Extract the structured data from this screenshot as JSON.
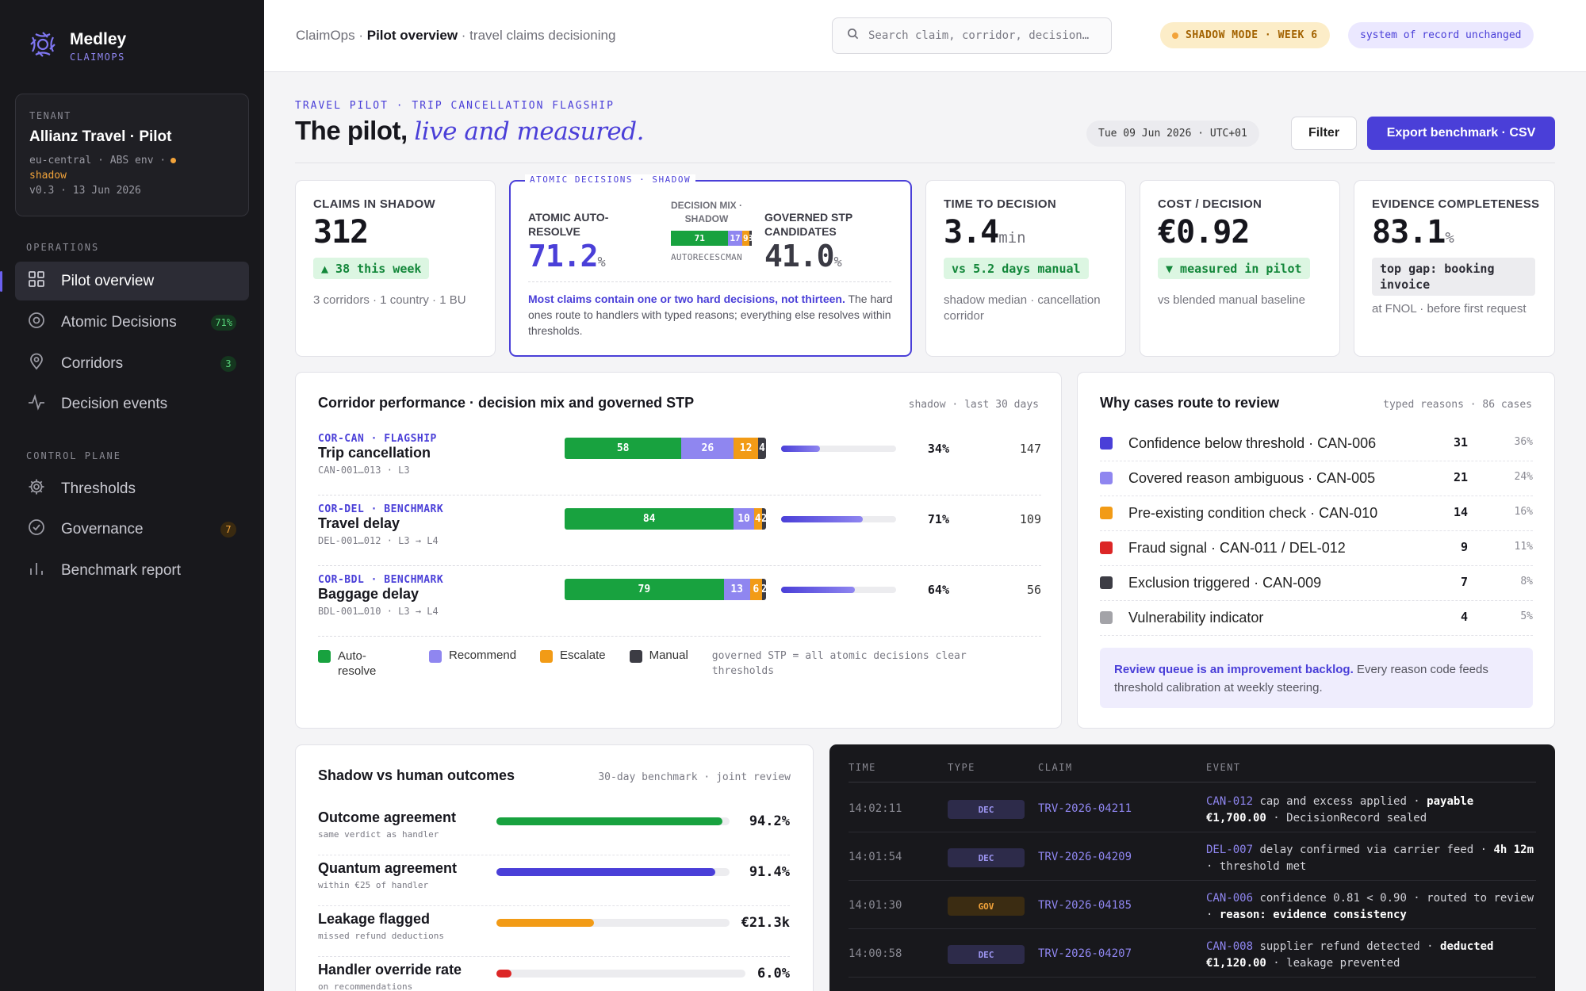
{
  "brand": {
    "name": "Medley",
    "sub": "CLAIMOPS"
  },
  "tenant": {
    "label": "TENANT",
    "name": "Allianz Travel · Pilot",
    "meta1": "eu-central · ABS env ·",
    "meta_status": "shadow",
    "version": "v0.3 · 13 Jun 2026"
  },
  "sidebar": {
    "operations_label": "OPERATIONS",
    "control_label": "CONTROL PLANE",
    "items": [
      {
        "label": "Pilot overview",
        "icon": "grid-icon"
      },
      {
        "label": "Atomic Decisions",
        "icon": "target-icon",
        "badge": "71%"
      },
      {
        "label": "Corridors",
        "icon": "pin-icon",
        "badge": "3"
      },
      {
        "label": "Decision events",
        "icon": "pulse-icon"
      },
      {
        "label": "Thresholds",
        "icon": "gear-icon"
      },
      {
        "label": "Governance",
        "icon": "check-circle-icon",
        "badge": "7"
      },
      {
        "label": "Benchmark report",
        "icon": "bar-chart-icon"
      }
    ]
  },
  "topbar": {
    "crumb_root": "ClaimOps",
    "crumb_page": "Pilot overview",
    "crumb_tail": "· travel claims decisioning",
    "search_placeholder": "Search claim, corridor, decision…",
    "pill_shadow": "SHADOW MODE · WEEK 6",
    "pill_sor": "system of record unchanged"
  },
  "header": {
    "eyebrow": "TRAVEL PILOT · TRIP CANCELLATION FLAGSHIP",
    "title_a": "The pilot,",
    "title_b": "live and measured.",
    "date": "Tue 09 Jun 2026 · UTC+01",
    "filter": "Filter",
    "export": "Export benchmark · CSV"
  },
  "kpis": {
    "claims": {
      "label": "CLAIMS IN SHADOW",
      "value": "312",
      "delta": "▲ 38 this week",
      "note": "3 corridors · 1 country · 1 BU"
    },
    "atomic": {
      "tag": "ATOMIC DECISIONS · SHADOW",
      "auto_label": "ATOMIC AUTO-RESOLVE",
      "auto_value": "71.2",
      "auto_unit": "%",
      "mix_label": "DECISION MIX · SHADOW",
      "mix": [
        {
          "v": 71,
          "color": "#18a23f"
        },
        {
          "v": 17,
          "color": "#8f86f0"
        },
        {
          "v": 9,
          "color": "#f29b16"
        },
        {
          "v": 3,
          "color": "#3c3c44"
        }
      ],
      "mix_caption": "AUTORECESCMAN",
      "stp_label": "GOVERNED STP CANDIDATES",
      "stp_value": "41.0",
      "stp_unit": "%",
      "note_bold": "Most claims contain one or two hard decisions, not thirteen.",
      "note": " The hard ones route to handlers with typed reasons; everything else resolves within thresholds."
    },
    "time": {
      "label": "TIME TO DECISION",
      "value": "3.4",
      "unit": "min",
      "delta": "vs 5.2 days manual",
      "note": "shadow median · cancellation corridor"
    },
    "cost": {
      "label": "COST / DECISION",
      "value": "€0.92",
      "delta": "▼ measured in pilot",
      "note": "vs blended manual baseline"
    },
    "evidence": {
      "label": "EVIDENCE COMPLETENESS",
      "value": "83.1",
      "unit": "%",
      "delta": "top gap: booking invoice",
      "note": "at FNOL · before first request"
    }
  },
  "corridors": {
    "title": "Corridor performance · decision mix and governed STP",
    "meta": "shadow · last 30 days",
    "rows": [
      {
        "tag": "COR-CAN · FLAGSHIP",
        "name": "Trip cancellation",
        "codes": "CAN-001…013 · L3",
        "mix": [
          58,
          26,
          12,
          4
        ],
        "stp": 34,
        "stp_label": "34%",
        "count": "147"
      },
      {
        "tag": "COR-DEL · BENCHMARK",
        "name": "Travel delay",
        "codes": "DEL-001…012 · L3 → L4",
        "mix": [
          84,
          10,
          4,
          2
        ],
        "stp": 71,
        "stp_label": "71%",
        "count": "109"
      },
      {
        "tag": "COR-BDL · BENCHMARK",
        "name": "Baggage delay",
        "codes": "BDL-001…010 · L3 → L4",
        "mix": [
          79,
          13,
          6,
          2
        ],
        "stp": 64,
        "stp_label": "64%",
        "count": "56"
      }
    ],
    "legend": [
      {
        "label": "Auto-resolve",
        "color": "#18a23f"
      },
      {
        "label": "Recommend",
        "color": "#8f86f0"
      },
      {
        "label": "Escalate",
        "color": "#f29b16"
      },
      {
        "label": "Manual",
        "color": "#3c3c44"
      }
    ],
    "legend_note": "governed STP = all atomic decisions clear thresholds"
  },
  "reasons": {
    "title": "Why cases route to review",
    "meta": "typed reasons · 86 cases",
    "rows": [
      {
        "label": "Confidence below threshold · CAN-006",
        "count": "31",
        "pct": "36%",
        "color": "#4a3fd8"
      },
      {
        "label": "Covered reason ambiguous · CAN-005",
        "count": "21",
        "pct": "24%",
        "color": "#8f86f0"
      },
      {
        "label": "Pre-existing condition check · CAN-010",
        "count": "14",
        "pct": "16%",
        "color": "#f29b16"
      },
      {
        "label": "Fraud signal · CAN-011 / DEL-012",
        "count": "9",
        "pct": "11%",
        "color": "#dc2626"
      },
      {
        "label": "Exclusion triggered · CAN-009",
        "count": "7",
        "pct": "8%",
        "color": "#3c3c44"
      },
      {
        "label": "Vulnerability indicator",
        "count": "4",
        "pct": "5%",
        "color": "#a3a3a8"
      }
    ],
    "note_bold": "Review queue is an improvement backlog.",
    "note": " Every reason code feeds threshold calibration at weekly steering."
  },
  "outcomes": {
    "title": "Shadow vs human outcomes",
    "meta": "30-day benchmark · joint review",
    "rows": [
      {
        "label": "Outcome agreement",
        "sub": "same verdict as handler",
        "value": "94.2%",
        "fill": 0.97,
        "color": "#18a23f"
      },
      {
        "label": "Quantum agreement",
        "sub": "within €25 of handler",
        "value": "91.4%",
        "fill": 0.94,
        "color": "#4a3fd8"
      },
      {
        "label": "Leakage flagged",
        "sub": "missed refund deductions",
        "value": "€21.3k",
        "fill": 0.42,
        "color": "#f29b16"
      },
      {
        "label": "Handler override rate",
        "sub": "on recommendations",
        "value": "6.0%",
        "fill": 0.06,
        "color": "#dc2626"
      }
    ]
  },
  "events": {
    "headers": {
      "time": "TIME",
      "type": "TYPE",
      "claim": "CLAIM",
      "event": "EVENT"
    },
    "rows": [
      {
        "time": "14:02:11",
        "type": "DEC",
        "claim": "TRV-2026-04211",
        "code": "CAN-012",
        "text": " cap and excess applied · ",
        "bold": "payable €1,700.00",
        "tail": " · DecisionRecord sealed"
      },
      {
        "time": "14:01:54",
        "type": "DEC",
        "claim": "TRV-2026-04209",
        "code": "DEL-007",
        "text": " delay confirmed via carrier feed · ",
        "bold": "4h 12m",
        "tail": " · threshold met"
      },
      {
        "time": "14:01:30",
        "type": "GOV",
        "claim": "TRV-2026-04185",
        "code": "CAN-006",
        "text": " confidence 0.81 < 0.90 · routed to review · ",
        "bold": "reason: evidence consistency",
        "tail": ""
      },
      {
        "time": "14:00:58",
        "type": "DEC",
        "claim": "TRV-2026-04207",
        "code": "CAN-008",
        "text": " supplier refund detected · ",
        "bold": "deducted €1,120.00",
        "tail": " · leakage prevented"
      }
    ]
  }
}
